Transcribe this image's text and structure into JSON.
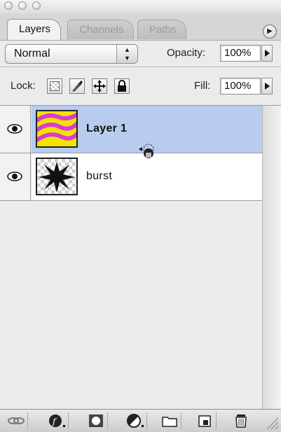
{
  "tabs": [
    "Layers",
    "Channels",
    "Paths"
  ],
  "blend_mode": "Normal",
  "opacity": {
    "label": "Opacity:",
    "value": "100%"
  },
  "lock": {
    "label": "Lock:"
  },
  "fill": {
    "label": "Fill:",
    "value": "100%"
  },
  "layers": [
    {
      "name": "Layer 1",
      "selected": true,
      "visible": true
    },
    {
      "name": "burst",
      "selected": false,
      "visible": true
    }
  ],
  "colors": {
    "selection": "#b8ccef",
    "layer1_thumb_yellow": "#f2e300",
    "layer1_thumb_magenta": "#d93ad6"
  },
  "icons": {
    "window_buttons": [
      "close-icon",
      "minimize-icon",
      "zoom-icon"
    ],
    "panel_menu": "panel-menu-icon",
    "lock_buttons": [
      "lock-transparency-icon",
      "lock-image-icon",
      "lock-position-icon",
      "lock-all-icon"
    ],
    "bottom_toolbar": [
      "link-layers-icon",
      "layer-style-icon",
      "add-mask-icon",
      "adjustment-layer-icon",
      "new-group-icon",
      "new-layer-icon",
      "trash-icon"
    ]
  }
}
